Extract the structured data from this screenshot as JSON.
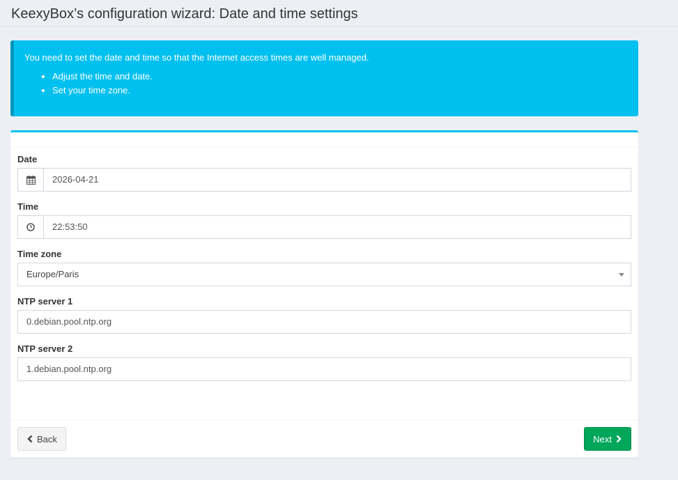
{
  "header": {
    "title": "KeexyBox’s configuration wizard: Date and time settings"
  },
  "callout": {
    "text": "You need to set the date and time so that the Internet access times are well managed.",
    "items": [
      "Adjust the time and date.",
      "Set your time zone."
    ]
  },
  "form": {
    "date": {
      "label": "Date",
      "value": "2026-04-21",
      "icon": "calendar-icon"
    },
    "time": {
      "label": "Time",
      "value": "22:53:50",
      "icon": "clock-icon"
    },
    "timezone": {
      "label": "Time zone",
      "value": "Europe/Paris"
    },
    "ntp1": {
      "label": "NTP server 1",
      "value": "0.debian.pool.ntp.org"
    },
    "ntp2": {
      "label": "NTP server 2",
      "value": "1.debian.pool.ntp.org"
    }
  },
  "footer": {
    "back_label": "Back",
    "next_label": "Next"
  },
  "colors": {
    "callout": "#00c0ef",
    "next_button": "#00a65a",
    "background": "#ecf0f5"
  }
}
